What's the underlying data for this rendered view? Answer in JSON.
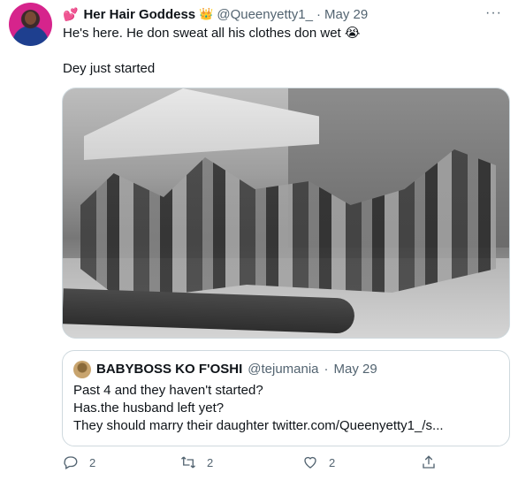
{
  "tweet": {
    "author": {
      "display_name": "Her Hair Goddess",
      "name_emoji_prefix": "💕",
      "name_emoji_suffix": "👑",
      "handle": "@Queenyetty1_",
      "separator": "·",
      "date": "May 29"
    },
    "text_line1": "He's here. He don sweat all his clothes don wet 😭",
    "text_line2": "Dey just started",
    "more_icon": "more-horizontal-icon",
    "quoted": {
      "display_name": "BABYBOSS KO F'OSHI",
      "handle": "@tejumania",
      "separator": "·",
      "date": "May 29",
      "line1": "Past 4 and they haven't started?",
      "line2": "Has.the husband left yet?",
      "line3": "They should marry their daughter twitter.com/Queenyetty1_/s..."
    },
    "actions": {
      "reply_count": "2",
      "retweet_count": "2",
      "like_count": "2"
    }
  },
  "colors": {
    "secondary_text": "#536471",
    "border": "#cfd9de",
    "heart": "#e0245e"
  }
}
